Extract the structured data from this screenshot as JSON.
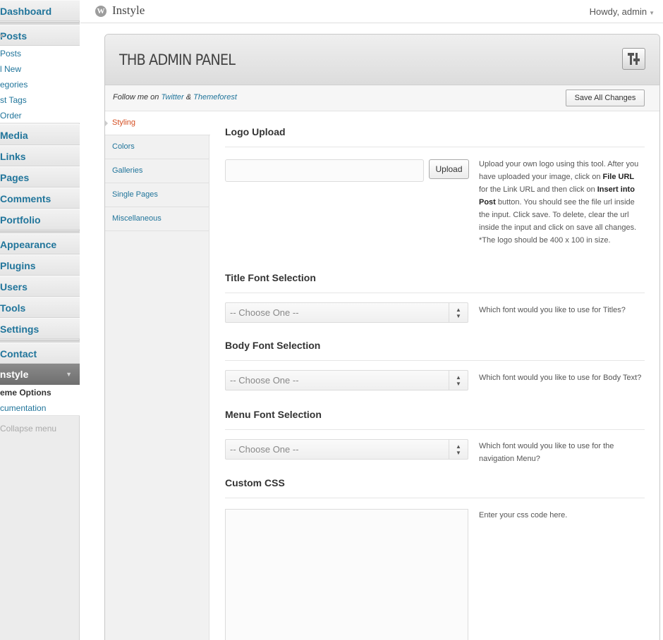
{
  "sidebar": {
    "top_items": [
      {
        "label": "Dashboard"
      },
      {
        "label": "Posts"
      },
      {
        "label": "Media"
      },
      {
        "label": "Links"
      },
      {
        "label": "Pages"
      },
      {
        "label": "Comments"
      },
      {
        "label": "Portfolio"
      },
      {
        "label": "Appearance"
      },
      {
        "label": "Plugins"
      },
      {
        "label": "Users"
      },
      {
        "label": "Tools"
      },
      {
        "label": "Settings"
      },
      {
        "label": "Contact"
      },
      {
        "label": "Instyle"
      }
    ],
    "posts_submenu": [
      "Posts",
      "l New",
      "egories",
      "st Tags",
      "Order"
    ],
    "instyle_submenu": [
      "eme Options",
      "cumentation"
    ],
    "collapse_label": "Collapse menu"
  },
  "header": {
    "site_title": "Instyle",
    "howdy": "Howdy, admin"
  },
  "panel": {
    "title": "THB ADMIN PANEL",
    "follow_prefix": "Follow me on",
    "follow_twitter": "Twitter",
    "follow_amp": "&",
    "follow_themeforest": "Themeforest",
    "save_label": "Save All Changes",
    "tabs": [
      {
        "label": "Styling",
        "active": true
      },
      {
        "label": "Colors"
      },
      {
        "label": "Galleries"
      },
      {
        "label": "Single Pages"
      },
      {
        "label": "Miscellaneous"
      }
    ]
  },
  "sections": {
    "logo": {
      "title": "Logo Upload",
      "upload_label": "Upload",
      "desc_1": "Upload your own logo using this tool. After you have uploaded your image, click on",
      "desc_b1": "File URL",
      "desc_2": "for the Link URL and then click on",
      "desc_b2": "Insert into Post",
      "desc_3": "button. You should see the file url inside the input. Click save. To delete, clear the url inside the input and click on save all changes. *The logo should be 400 x 100 in size."
    },
    "title_font": {
      "title": "Title Font Selection",
      "selected": "-- Choose One --",
      "desc": "Which font would you like to use for Titles?"
    },
    "body_font": {
      "title": "Body Font Selection",
      "selected": "-- Choose One --",
      "desc": "Which font would you like to use for Body Text?"
    },
    "menu_font": {
      "title": "Menu Font Selection",
      "selected": "-- Choose One --",
      "desc": "Which font would you like to use for the navigation Menu?"
    },
    "custom_css": {
      "title": "Custom CSS",
      "desc": "Enter your css code here."
    }
  }
}
